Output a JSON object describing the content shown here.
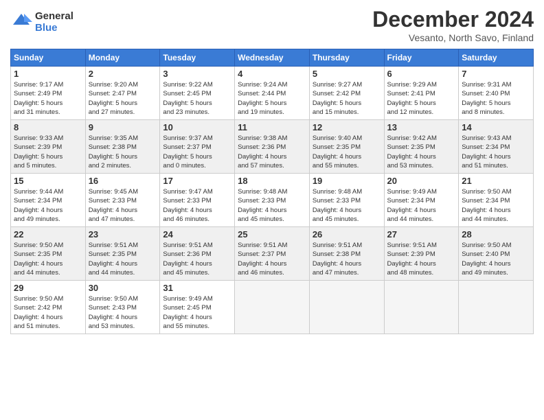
{
  "header": {
    "logo_line1": "General",
    "logo_line2": "Blue",
    "month": "December 2024",
    "location": "Vesanto, North Savo, Finland"
  },
  "days_of_week": [
    "Sunday",
    "Monday",
    "Tuesday",
    "Wednesday",
    "Thursday",
    "Friday",
    "Saturday"
  ],
  "weeks": [
    [
      {
        "day": "1",
        "text": "Sunrise: 9:17 AM\nSunset: 2:49 PM\nDaylight: 5 hours\nand 31 minutes."
      },
      {
        "day": "2",
        "text": "Sunrise: 9:20 AM\nSunset: 2:47 PM\nDaylight: 5 hours\nand 27 minutes."
      },
      {
        "day": "3",
        "text": "Sunrise: 9:22 AM\nSunset: 2:45 PM\nDaylight: 5 hours\nand 23 minutes."
      },
      {
        "day": "4",
        "text": "Sunrise: 9:24 AM\nSunset: 2:44 PM\nDaylight: 5 hours\nand 19 minutes."
      },
      {
        "day": "5",
        "text": "Sunrise: 9:27 AM\nSunset: 2:42 PM\nDaylight: 5 hours\nand 15 minutes."
      },
      {
        "day": "6",
        "text": "Sunrise: 9:29 AM\nSunset: 2:41 PM\nDaylight: 5 hours\nand 12 minutes."
      },
      {
        "day": "7",
        "text": "Sunrise: 9:31 AM\nSunset: 2:40 PM\nDaylight: 5 hours\nand 8 minutes."
      }
    ],
    [
      {
        "day": "8",
        "text": "Sunrise: 9:33 AM\nSunset: 2:39 PM\nDaylight: 5 hours\nand 5 minutes."
      },
      {
        "day": "9",
        "text": "Sunrise: 9:35 AM\nSunset: 2:38 PM\nDaylight: 5 hours\nand 2 minutes."
      },
      {
        "day": "10",
        "text": "Sunrise: 9:37 AM\nSunset: 2:37 PM\nDaylight: 5 hours\nand 0 minutes."
      },
      {
        "day": "11",
        "text": "Sunrise: 9:38 AM\nSunset: 2:36 PM\nDaylight: 4 hours\nand 57 minutes."
      },
      {
        "day": "12",
        "text": "Sunrise: 9:40 AM\nSunset: 2:35 PM\nDaylight: 4 hours\nand 55 minutes."
      },
      {
        "day": "13",
        "text": "Sunrise: 9:42 AM\nSunset: 2:35 PM\nDaylight: 4 hours\nand 53 minutes."
      },
      {
        "day": "14",
        "text": "Sunrise: 9:43 AM\nSunset: 2:34 PM\nDaylight: 4 hours\nand 51 minutes."
      }
    ],
    [
      {
        "day": "15",
        "text": "Sunrise: 9:44 AM\nSunset: 2:34 PM\nDaylight: 4 hours\nand 49 minutes."
      },
      {
        "day": "16",
        "text": "Sunrise: 9:45 AM\nSunset: 2:33 PM\nDaylight: 4 hours\nand 47 minutes."
      },
      {
        "day": "17",
        "text": "Sunrise: 9:47 AM\nSunset: 2:33 PM\nDaylight: 4 hours\nand 46 minutes."
      },
      {
        "day": "18",
        "text": "Sunrise: 9:48 AM\nSunset: 2:33 PM\nDaylight: 4 hours\nand 45 minutes."
      },
      {
        "day": "19",
        "text": "Sunrise: 9:48 AM\nSunset: 2:33 PM\nDaylight: 4 hours\nand 45 minutes."
      },
      {
        "day": "20",
        "text": "Sunrise: 9:49 AM\nSunset: 2:34 PM\nDaylight: 4 hours\nand 44 minutes."
      },
      {
        "day": "21",
        "text": "Sunrise: 9:50 AM\nSunset: 2:34 PM\nDaylight: 4 hours\nand 44 minutes."
      }
    ],
    [
      {
        "day": "22",
        "text": "Sunrise: 9:50 AM\nSunset: 2:35 PM\nDaylight: 4 hours\nand 44 minutes."
      },
      {
        "day": "23",
        "text": "Sunrise: 9:51 AM\nSunset: 2:35 PM\nDaylight: 4 hours\nand 44 minutes."
      },
      {
        "day": "24",
        "text": "Sunrise: 9:51 AM\nSunset: 2:36 PM\nDaylight: 4 hours\nand 45 minutes."
      },
      {
        "day": "25",
        "text": "Sunrise: 9:51 AM\nSunset: 2:37 PM\nDaylight: 4 hours\nand 46 minutes."
      },
      {
        "day": "26",
        "text": "Sunrise: 9:51 AM\nSunset: 2:38 PM\nDaylight: 4 hours\nand 47 minutes."
      },
      {
        "day": "27",
        "text": "Sunrise: 9:51 AM\nSunset: 2:39 PM\nDaylight: 4 hours\nand 48 minutes."
      },
      {
        "day": "28",
        "text": "Sunrise: 9:50 AM\nSunset: 2:40 PM\nDaylight: 4 hours\nand 49 minutes."
      }
    ],
    [
      {
        "day": "29",
        "text": "Sunrise: 9:50 AM\nSunset: 2:42 PM\nDaylight: 4 hours\nand 51 minutes."
      },
      {
        "day": "30",
        "text": "Sunrise: 9:50 AM\nSunset: 2:43 PM\nDaylight: 4 hours\nand 53 minutes."
      },
      {
        "day": "31",
        "text": "Sunrise: 9:49 AM\nSunset: 2:45 PM\nDaylight: 4 hours\nand 55 minutes."
      },
      {
        "day": "",
        "text": ""
      },
      {
        "day": "",
        "text": ""
      },
      {
        "day": "",
        "text": ""
      },
      {
        "day": "",
        "text": ""
      }
    ]
  ]
}
